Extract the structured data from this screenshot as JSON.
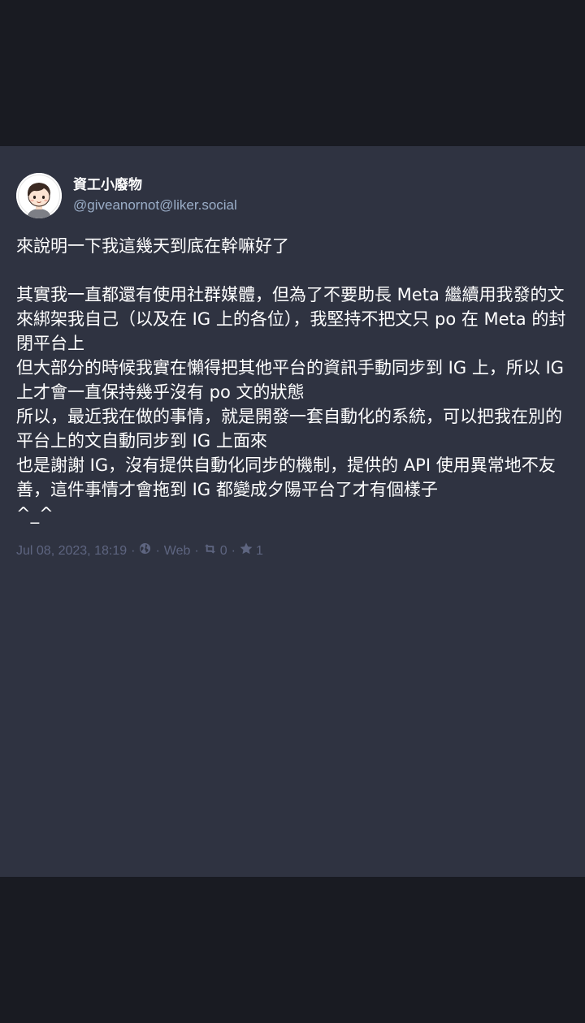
{
  "status": {
    "author": {
      "display_name": "資工小廢物",
      "handle": "@giveanornot@liker.social",
      "avatar_icon": "cartoon-avatar-icon"
    },
    "paragraphs": [
      "來說明一下我這幾天到底在幹嘛好了",
      "其實我一直都還有使用社群媒體，但為了不要助長 Meta 繼續用我發的文來綁架我自己（以及在 IG 上的各位），我堅持不把文只 po 在 Meta 的封閉平台上\n但大部分的時候我實在懶得把其他平台的資訊手動同步到 IG 上，所以 IG 上才會一直保持幾乎沒有 po 文的狀態\n所以，最近我在做的事情，就是開發一套自動化的系統，可以把我在別的平台上的文自動同步到 IG 上面來\n也是謝謝 IG，沒有提供自動化同步的機制，提供的 API 使用異常地不友善，這件事情才會拖到 IG 都變成夕陽平台了才有個樣子\n^_^"
    ],
    "meta": {
      "timestamp": "Jul 08, 2023, 18:19",
      "separator": "·",
      "visibility_icon": "globe-icon",
      "application": "Web",
      "boost_icon": "retweet-icon",
      "boosts": "0",
      "favourite_icon": "star-icon",
      "favourites": "1"
    }
  },
  "colors": {
    "background": "#191b22",
    "card": "#2f3341",
    "text": "#ffffff",
    "handle": "#9baec8",
    "meta": "#5e6580"
  }
}
